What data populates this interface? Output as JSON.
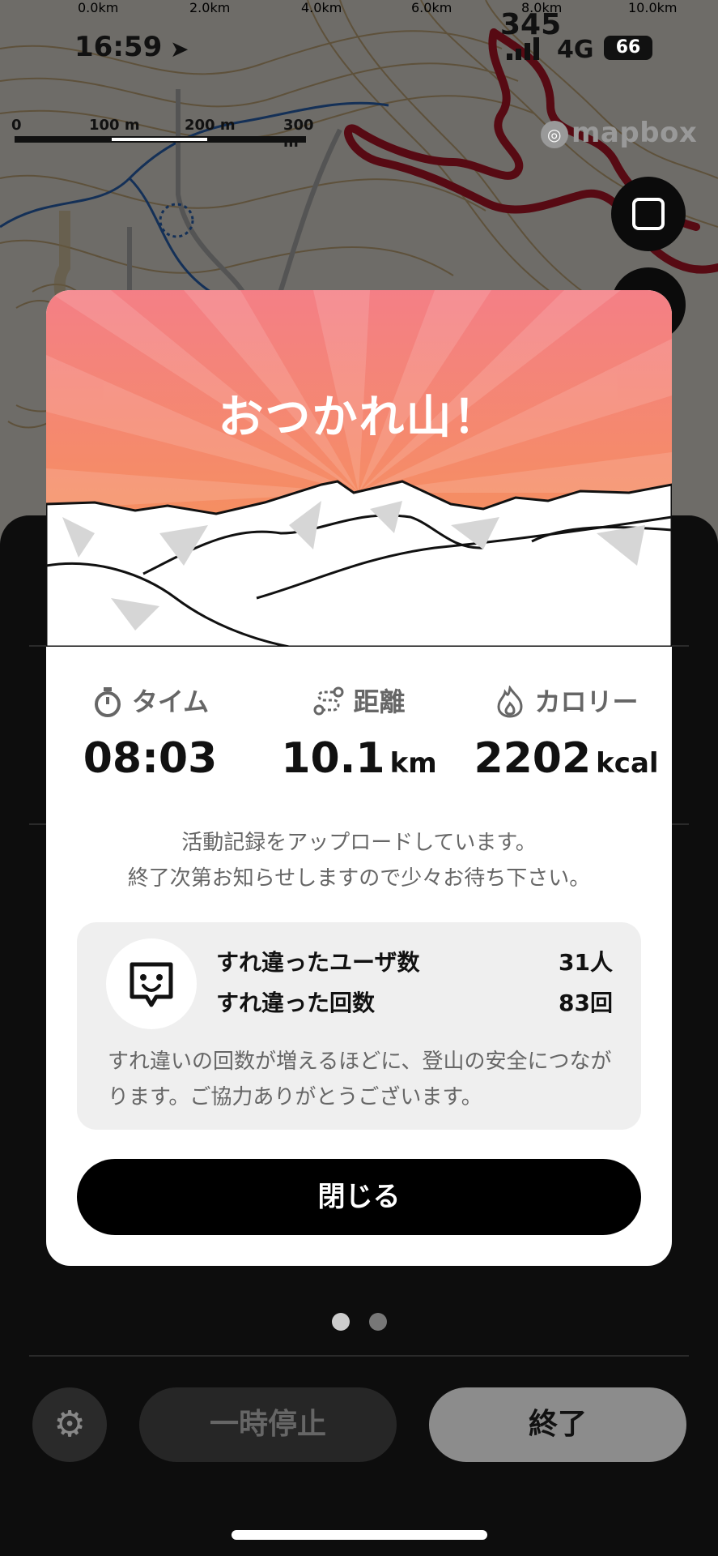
{
  "status_bar": {
    "time": "16:59",
    "location_arrow": "location-arrow-icon",
    "elevation": "345",
    "network": "4G",
    "battery": "66"
  },
  "map": {
    "scale_labels": [
      "0",
      "100 m",
      "200 m",
      "300 m"
    ],
    "attribution": "mapbox",
    "route_color": "#c0182a"
  },
  "modal": {
    "title": "おつかれ山！",
    "stats": [
      {
        "icon": "stopwatch-icon",
        "label": "タイム",
        "value": "08:03",
        "unit": ""
      },
      {
        "icon": "route-icon",
        "label": "距離",
        "value": "10.1",
        "unit": "km"
      },
      {
        "icon": "flame-icon",
        "label": "カロリー",
        "value": "2202",
        "unit": "kcal"
      }
    ],
    "message_line1": "活動記録をアップロードしています。",
    "message_line2": "終了次第お知らせしますので少々お待ち下さい。",
    "passing": {
      "icon": "face-badge-icon",
      "users_label": "すれ違ったユーザ数",
      "users_value": "31人",
      "count_label": "すれ違った回数",
      "count_value": "83回",
      "note": "すれ違いの回数が増えるほどに、登山の安全につながります。ご協力ありがとうございます。"
    },
    "close_label": "閉じる"
  },
  "background_sheet": {
    "axis_ticks": [
      "0.0km",
      "2.0km",
      "4.0km",
      "6.0km",
      "8.0km",
      "10.0km"
    ],
    "pause_label": "一時停止",
    "end_label": "終了",
    "settings_icon": "gear-icon"
  },
  "colors": {
    "hero_top": "#f47f86",
    "hero_bottom": "#f6974c",
    "button_black": "#000000"
  }
}
